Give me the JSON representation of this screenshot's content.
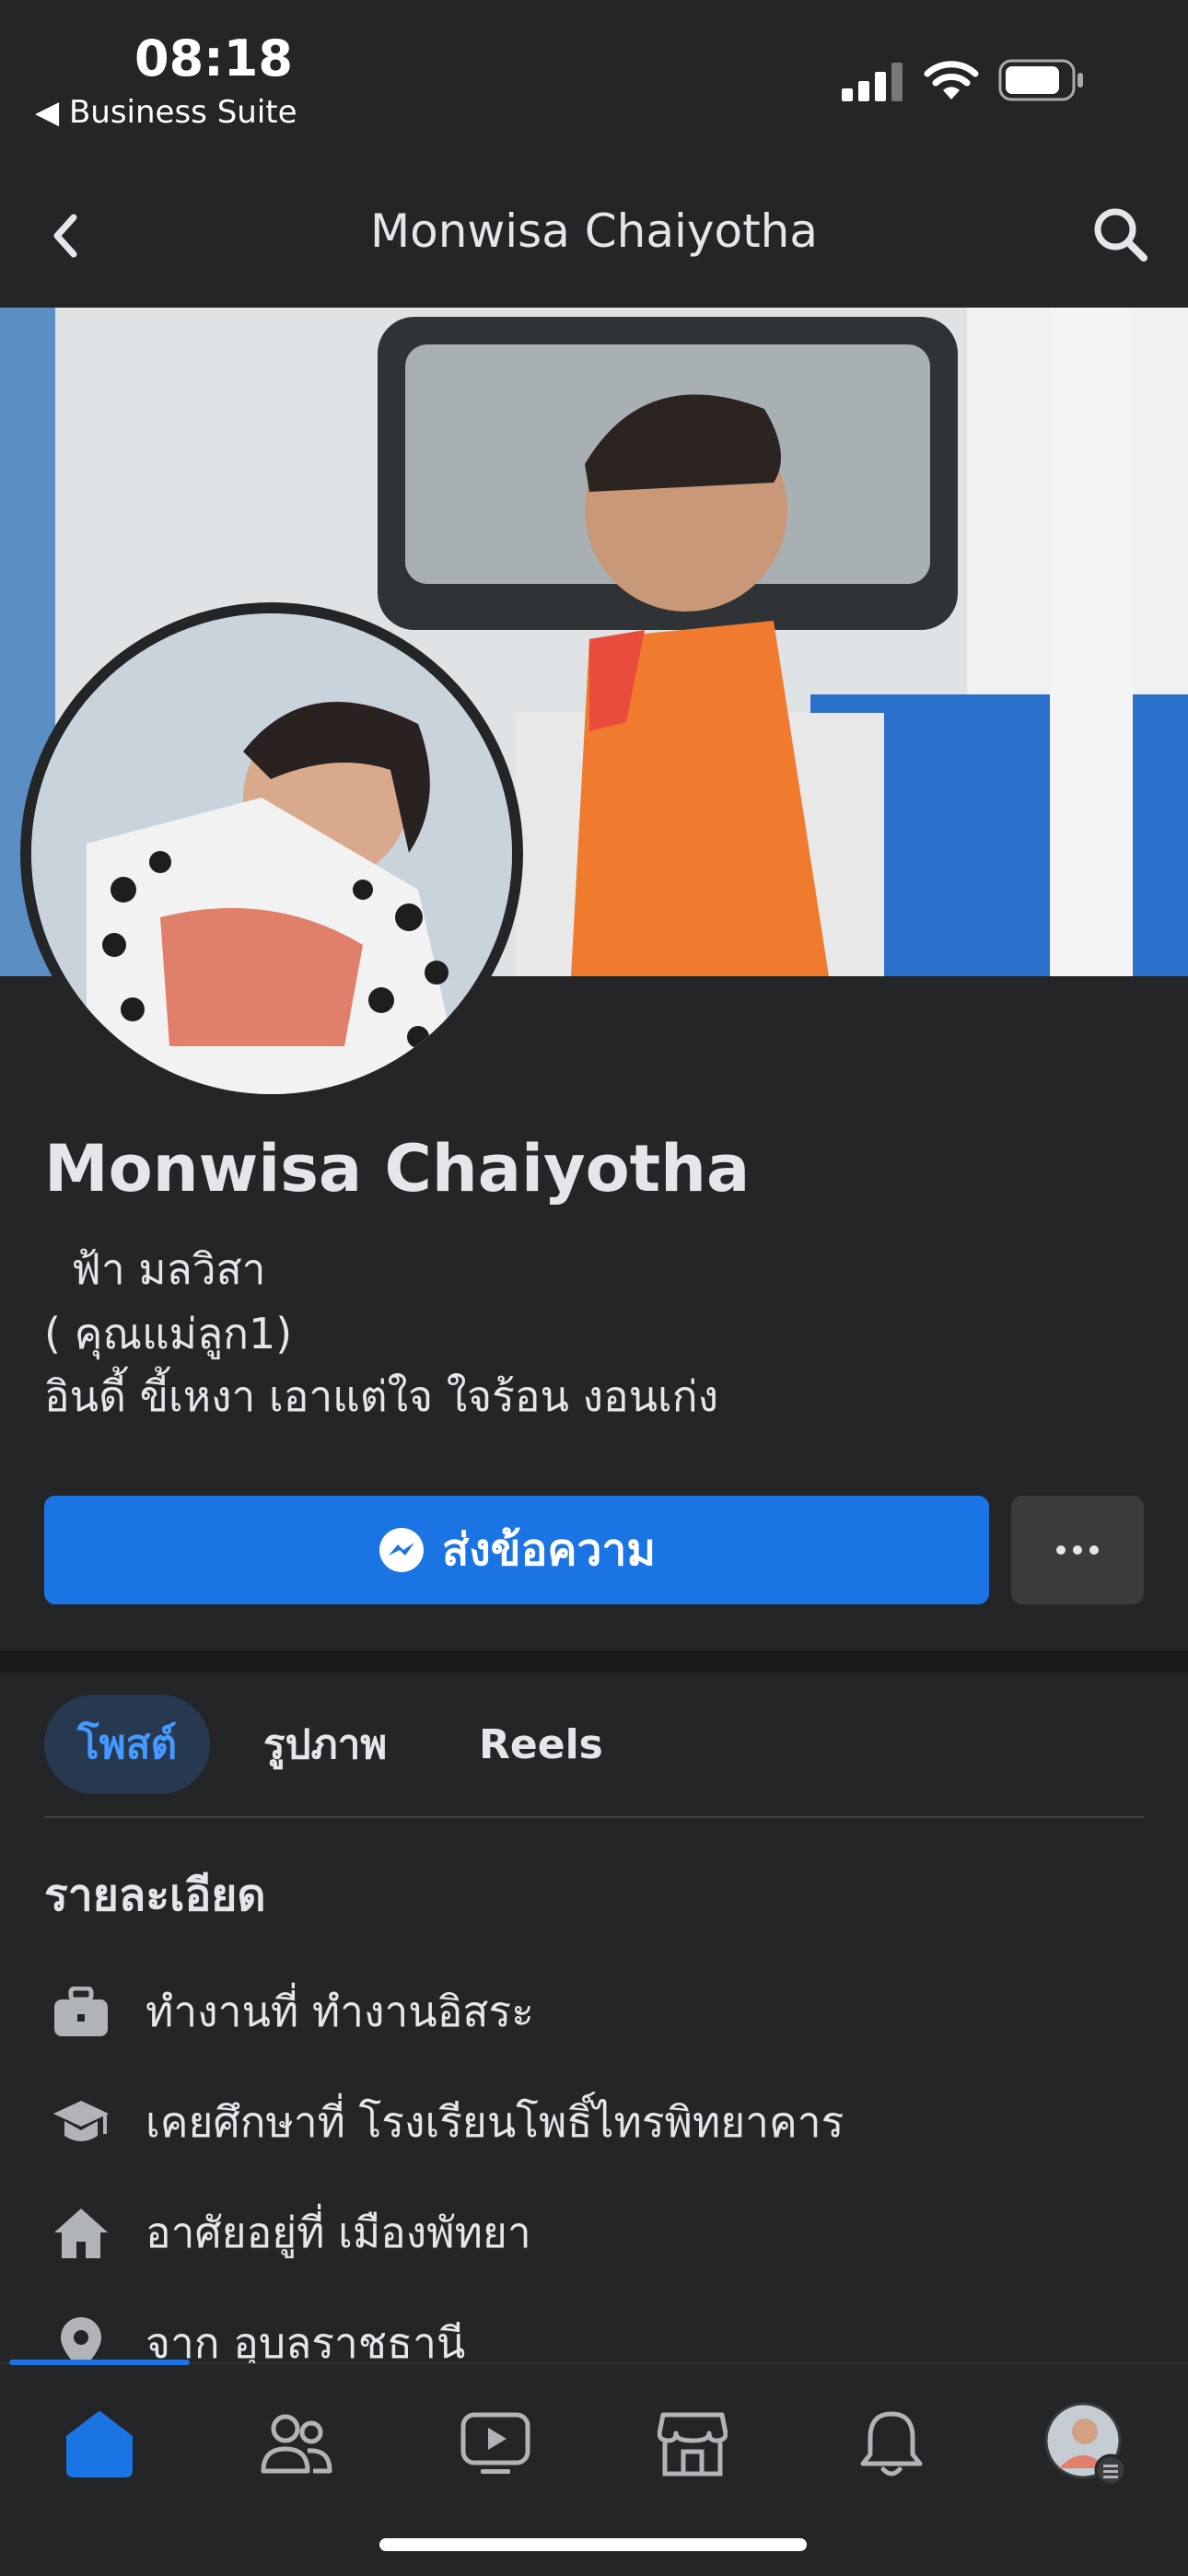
{
  "status_bar": {
    "time": "08:18",
    "back_app": "◀ Business Suite"
  },
  "header": {
    "title": "Monwisa Chaiyotha"
  },
  "profile": {
    "name": "Monwisa Chaiyotha",
    "bio": [
      "  ฟ้า มลวิสา",
      "( คุณแม่ลูก1)",
      "อินดี้ ขี้เหงา เอาแต่ใจ ใจร้อน งอนเก่ง"
    ]
  },
  "actions": {
    "message_label": "ส่งข้อความ"
  },
  "tabs": [
    {
      "label": "โพสต์",
      "active": true
    },
    {
      "label": "รูปภาพ",
      "active": false
    },
    {
      "label": "Reels",
      "active": false
    }
  ],
  "details": {
    "heading": "รายละเอียด",
    "items": [
      {
        "icon": "briefcase-icon",
        "text": "ทำงานที่ ทำงานอิสระ"
      },
      {
        "icon": "graduation-cap-icon",
        "text": "เคยศึกษาที่ โรงเรียนโพธิ์ไทรพิทยาคาร"
      },
      {
        "icon": "house-icon",
        "text": "อาศัยอยู่ที่ เมืองพัทยา"
      },
      {
        "icon": "location-pin-icon",
        "text": "จาก อุบลราชธานี"
      }
    ]
  },
  "bottom_nav": [
    "home-icon",
    "friends-icon",
    "video-icon",
    "marketplace-icon",
    "bell-icon",
    "profile-avatar"
  ],
  "colors": {
    "accent": "#1b74e4",
    "background": "#242526",
    "tab_active_bg": "#263951"
  }
}
